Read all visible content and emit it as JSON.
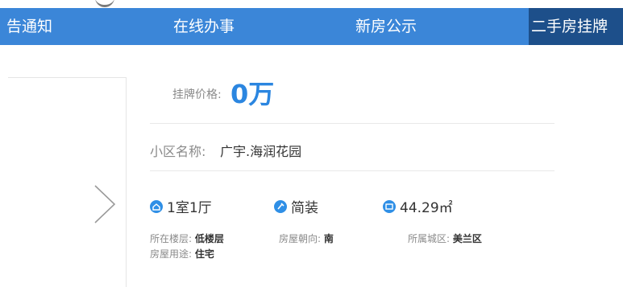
{
  "nav": {
    "items": [
      {
        "label": "告通知"
      },
      {
        "label": "在线办事"
      },
      {
        "label": "新房公示"
      },
      {
        "label": "二手房挂牌"
      }
    ]
  },
  "listing": {
    "price_label": "挂牌价格:",
    "price_value": "0万",
    "community_label": "小区名称:",
    "community_value": "广宇.海润花园",
    "features": [
      {
        "icon": "house-icon",
        "text": "1室1厅"
      },
      {
        "icon": "brush-icon",
        "text": "简装"
      },
      {
        "icon": "area-icon",
        "text": "44.29㎡"
      }
    ],
    "details": {
      "floor_label": "所在楼层:",
      "floor_value": "低楼层",
      "orientation_label": "房屋朝向:",
      "orientation_value": "南",
      "district_label": "所属城区:",
      "district_value": "美兰区",
      "usage_label": "房屋用途:",
      "usage_value": "住宅"
    }
  },
  "colors": {
    "nav_bg": "#3b86d8",
    "nav_active": "#1d4f8a",
    "price": "#2b86e0",
    "icon": "#2f8fe6"
  }
}
